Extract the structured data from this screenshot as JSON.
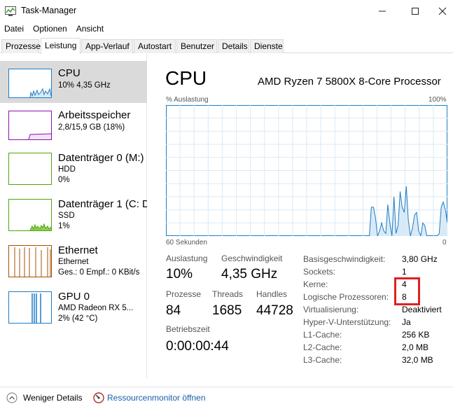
{
  "window": {
    "title": "Task-Manager",
    "minimize_icon": "minimize-icon",
    "maximize_icon": "maximize-icon",
    "close_icon": "close-icon"
  },
  "menu": [
    "Datei",
    "Optionen",
    "Ansicht"
  ],
  "tabs": [
    "Prozesse",
    "Leistung",
    "App-Verlauf",
    "Autostart",
    "Benutzer",
    "Details",
    "Dienste"
  ],
  "active_tab": "Leistung",
  "sidebar": {
    "items": [
      {
        "title": "CPU",
        "sub1": "10% 4,35 GHz",
        "sub2": "",
        "color": "#1e7cc6"
      },
      {
        "title": "Arbeitsspeicher",
        "sub1": "2,8/15,9 GB (18%)",
        "sub2": "",
        "color": "#8b12ae"
      },
      {
        "title": "Datenträger 0 (M:)",
        "sub1": "HDD",
        "sub2": "0%",
        "color": "#4da60c"
      },
      {
        "title": "Datenträger 1 (C: D",
        "sub1": "SSD",
        "sub2": "1%",
        "color": "#4da60c"
      },
      {
        "title": "Ethernet",
        "sub1": "Ethernet",
        "sub2": "Ges.: 0 Empf.: 0 KBit/s",
        "color": "#a74f01"
      },
      {
        "title": "GPU 0",
        "sub1": "AMD Radeon RX 5...",
        "sub2": "2% (42 °C)",
        "color": "#1e7cc6"
      }
    ]
  },
  "main": {
    "title": "CPU",
    "processor": "AMD Ryzen 7 5800X 8-Core Processor",
    "graph_label_left": "% Auslastung",
    "graph_label_right": "100%",
    "time_left": "60 Sekunden",
    "time_right": "0",
    "graph_color": "#1e7cc6",
    "graph_series": [
      0,
      0,
      0,
      0,
      0,
      0,
      0,
      0,
      0,
      0,
      0,
      0,
      0,
      0,
      0,
      0,
      0,
      0,
      0,
      0,
      0,
      0,
      0,
      0,
      0,
      0,
      0,
      0,
      0,
      0,
      0,
      0,
      0,
      0,
      0,
      0,
      0,
      0,
      0,
      0,
      0,
      0,
      0,
      0,
      0,
      0,
      0,
      0,
      0,
      0,
      0,
      0,
      0,
      0,
      0,
      0,
      0,
      0,
      0,
      0,
      0,
      0,
      0,
      0,
      0,
      0,
      0,
      0,
      0,
      0,
      0,
      0,
      0,
      0,
      0,
      0,
      0,
      0,
      0,
      0,
      0,
      0,
      0,
      0,
      0,
      0,
      0,
      0,
      0,
      0,
      0,
      0,
      0,
      0,
      0,
      0,
      0,
      0,
      0,
      0,
      22,
      22,
      14,
      0,
      4,
      10,
      4,
      2,
      24,
      10,
      0,
      30,
      2,
      8,
      34,
      22,
      18,
      38,
      12,
      0,
      6,
      16,
      18,
      4,
      0,
      10,
      8,
      0,
      0,
      0,
      0,
      0,
      0,
      2,
      22,
      26,
      20,
      10
    ],
    "stats": {
      "auslastung_label": "Auslastung",
      "auslastung_value": "10%",
      "geschwindigkeit_label": "Geschwindigkeit",
      "geschwindigkeit_value": "4,35 GHz",
      "prozesse_label": "Prozesse",
      "prozesse_value": "84",
      "threads_label": "Threads",
      "threads_value": "1685",
      "handles_label": "Handles",
      "handles_value": "44728",
      "betriebszeit_label": "Betriebszeit",
      "betriebszeit_value": "0:00:00:44"
    },
    "details": [
      {
        "label": "Basisgeschwindigkeit:",
        "value": "3,80 GHz"
      },
      {
        "label": "Sockets:",
        "value": "1"
      },
      {
        "label": "Kerne:",
        "value": "4"
      },
      {
        "label": "Logische Prozessoren:",
        "value": "8"
      },
      {
        "label": "Virtualisierung:",
        "value": "Deaktiviert"
      },
      {
        "label": "Hyper-V-Unterstützung:",
        "value": "Ja"
      },
      {
        "label": "L1-Cache:",
        "value": "256 KB"
      },
      {
        "label": "L2-Cache:",
        "value": "2,0 MB"
      },
      {
        "label": "L3-Cache:",
        "value": "32,0 MB"
      }
    ]
  },
  "footer": {
    "less_details": "Weniger Details",
    "resource_monitor": "Ressourcenmonitor öffnen"
  }
}
